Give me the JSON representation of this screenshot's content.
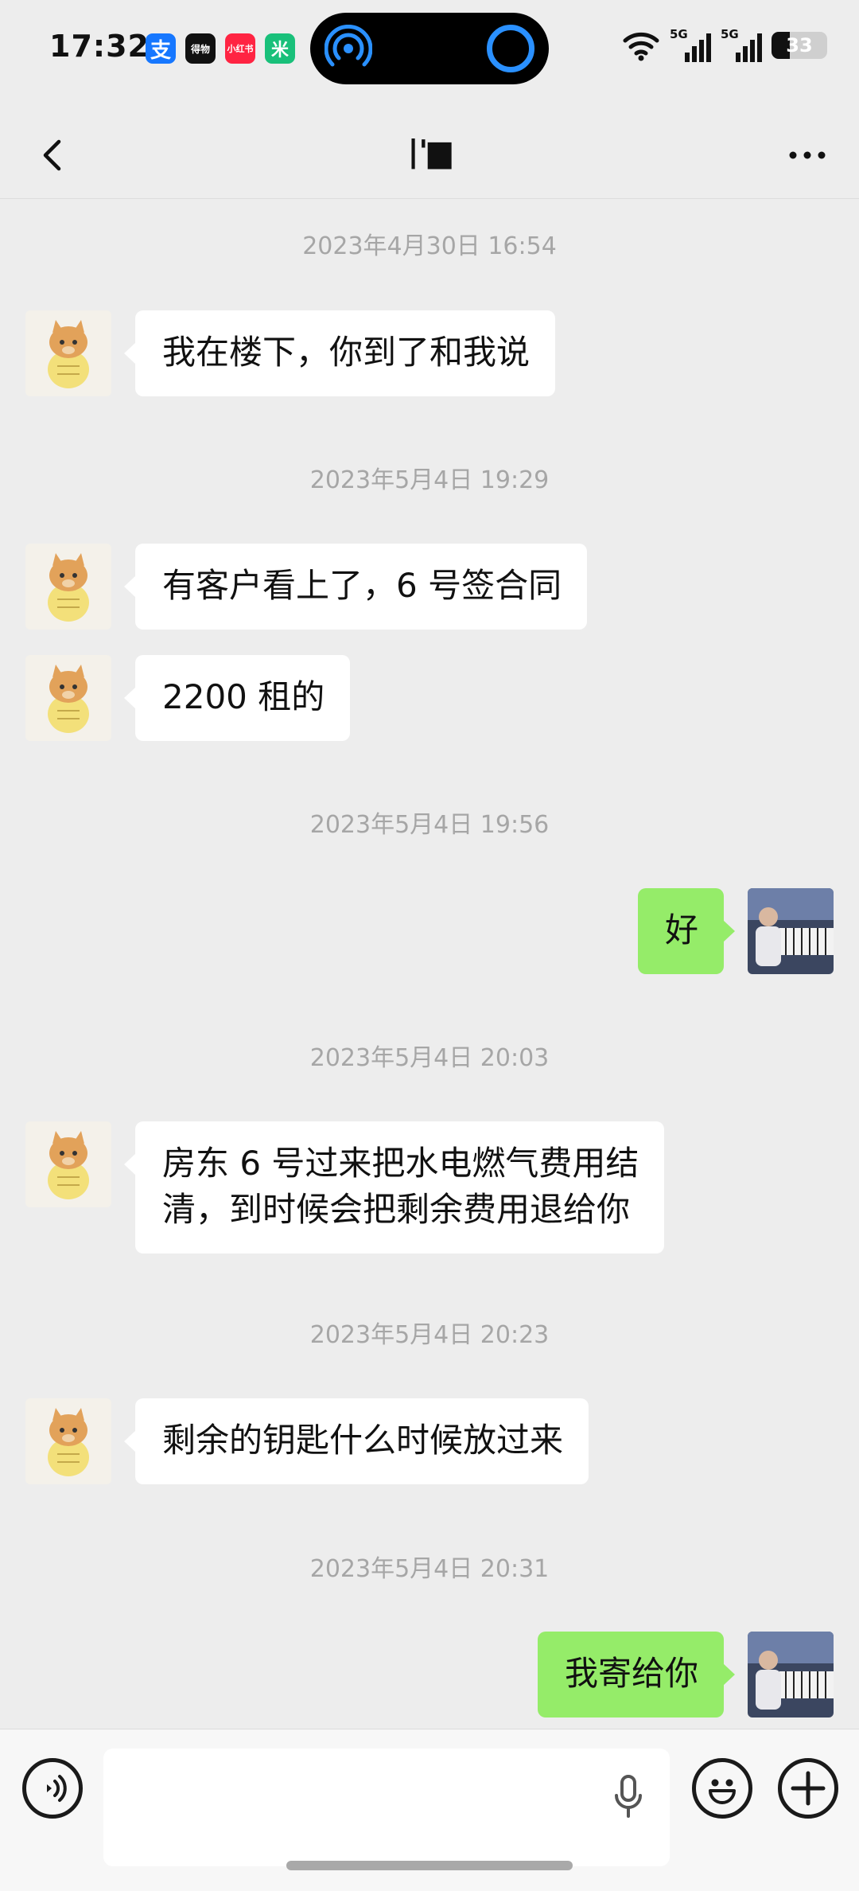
{
  "status_bar": {
    "time": "17:32",
    "apps": [
      {
        "icon": "alipay-icon",
        "label": "支",
        "color": "#1677ff"
      },
      {
        "icon": "dewu-icon",
        "label": "得物",
        "color": "#111111"
      },
      {
        "icon": "xiaohongshu-icon",
        "label": "小红书",
        "color": "#ff2442"
      },
      {
        "icon": "mi-home-icon",
        "label": "米",
        "color": "#19c07a"
      }
    ],
    "network_1": "5G",
    "network_2": "5G",
    "battery": "33",
    "battery_level": 0.33
  },
  "nav": {
    "title": "|'▆",
    "back_icon": "chevron-left-icon",
    "more_icon": "more-dots-icon"
  },
  "messages": [
    {
      "type": "time",
      "text": "2023年4月30日 16:54"
    },
    {
      "type": "in",
      "text": "我在楼下，你到了和我说"
    },
    {
      "type": "time",
      "text": "2023年5月4日 19:29"
    },
    {
      "type": "in",
      "text": "有客户看上了，6 号签合同"
    },
    {
      "type": "in",
      "text": "2200 租的"
    },
    {
      "type": "time",
      "text": "2023年5月4日 19:56"
    },
    {
      "type": "out",
      "text": "好"
    },
    {
      "type": "time",
      "text": "2023年5月4日 20:03"
    },
    {
      "type": "in",
      "text": "房东 6 号过来把水电燃气费用结",
      "text2": "清，到时候会把剩余费用退给你"
    },
    {
      "type": "time",
      "text": "2023年5月4日 20:23"
    },
    {
      "type": "in",
      "text": "剩余的钥匙什么时候放过来"
    },
    {
      "type": "time",
      "text": "2023年5月4日 20:31"
    },
    {
      "type": "out",
      "text": "我寄给你"
    }
  ],
  "input_bar": {
    "voice_icon": "voice-mode-icon",
    "mic_icon": "microphone-icon",
    "emoji_icon": "emoji-icon",
    "plus_icon": "plus-icon",
    "value": ""
  },
  "colors": {
    "background": "#ededed",
    "incoming_bubble": "#ffffff",
    "outgoing_bubble": "#95ec69",
    "timestamp": "#a6a6a6"
  }
}
